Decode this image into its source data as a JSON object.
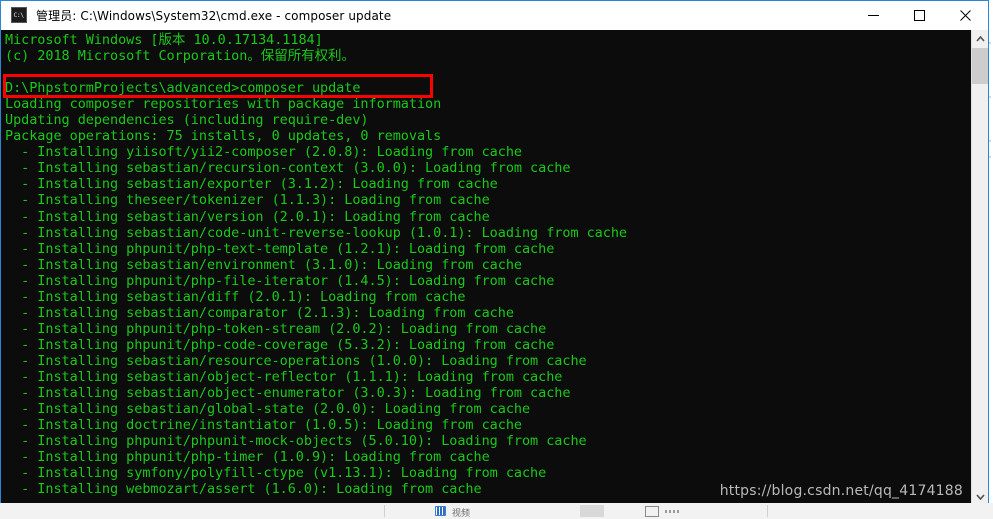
{
  "window": {
    "title": "管理员: C:\\Windows\\System32\\cmd.exe - composer  update",
    "icon": "cmd-console-icon",
    "minimize_label": "—",
    "maximize_label": "□",
    "close_label": "✕",
    "colors": {
      "border": "#2a87d8",
      "console_bg": "#0c0c0c",
      "console_fg": "#19c819",
      "annotation": "#ff0000",
      "watermark": "#b9b9b9"
    }
  },
  "console": {
    "lines": [
      "Microsoft Windows [版本 10.0.17134.1184]",
      "(c) 2018 Microsoft Corporation。保留所有权利。",
      "",
      "D:\\PhpstormProjects\\advanced>composer update",
      "Loading composer repositories with package information",
      "Updating dependencies (including require-dev)",
      "Package operations: 75 installs, 0 updates, 0 removals",
      "  - Installing yiisoft/yii2-composer (2.0.8): Loading from cache",
      "  - Installing sebastian/recursion-context (3.0.0): Loading from cache",
      "  - Installing sebastian/exporter (3.1.2): Loading from cache",
      "  - Installing theseer/tokenizer (1.1.3): Loading from cache",
      "  - Installing sebastian/version (2.0.1): Loading from cache",
      "  - Installing sebastian/code-unit-reverse-lookup (1.0.1): Loading from cache",
      "  - Installing phpunit/php-text-template (1.2.1): Loading from cache",
      "  - Installing sebastian/environment (3.1.0): Loading from cache",
      "  - Installing phpunit/php-file-iterator (1.4.5): Loading from cache",
      "  - Installing sebastian/diff (2.0.1): Loading from cache",
      "  - Installing sebastian/comparator (2.1.3): Loading from cache",
      "  - Installing phpunit/php-token-stream (2.0.2): Loading from cache",
      "  - Installing phpunit/php-code-coverage (5.3.2): Loading from cache",
      "  - Installing sebastian/resource-operations (1.0.0): Loading from cache",
      "  - Installing sebastian/object-reflector (1.1.1): Loading from cache",
      "  - Installing sebastian/object-enumerator (3.0.3): Loading from cache",
      "  - Installing sebastian/global-state (2.0.0): Loading from cache",
      "  - Installing doctrine/instantiator (1.0.5): Loading from cache",
      "  - Installing phpunit/phpunit-mock-objects (5.0.10): Loading from cache",
      "  - Installing phpunit/php-timer (1.0.9): Loading from cache",
      "  - Installing symfony/polyfill-ctype (v1.13.1): Loading from cache",
      "  - Installing webmozart/assert (1.6.0): Loading from cache"
    ],
    "command": "composer update",
    "prompt_path": "D:\\PhpstormProjects\\advanced>",
    "package_operations": {
      "installs": 75,
      "updates": 0,
      "removals": 0
    }
  },
  "annotation": {
    "highlighted_line": "D:\\PhpstormProjects\\advanced>composer update"
  },
  "watermark": {
    "text": "https://blog.csdn.net/qq_4174188"
  },
  "scrollbar": {
    "up_arrow": "chevron-up-icon",
    "down_arrow": "chevron-down-icon"
  },
  "taskbar": {
    "label": "视频"
  }
}
